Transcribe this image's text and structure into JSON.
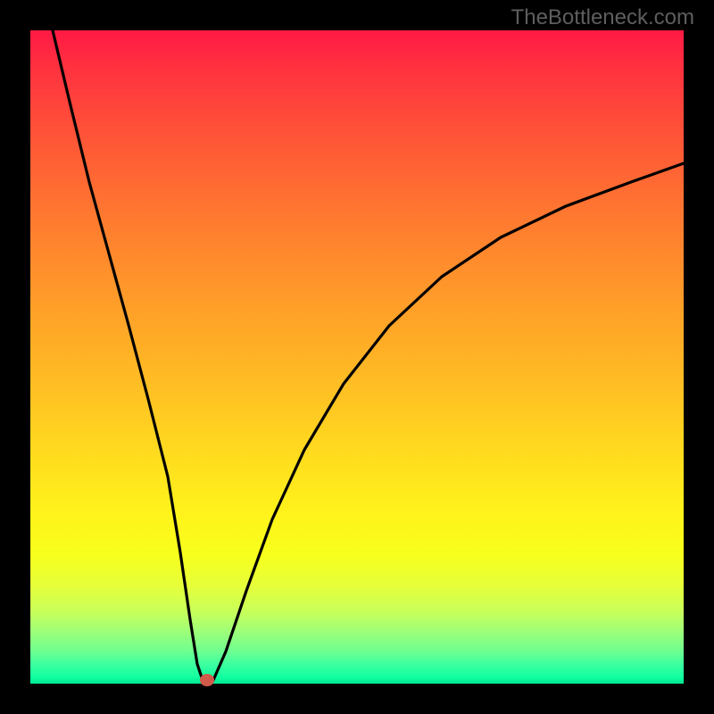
{
  "watermark": "TheBottleneck.com",
  "chart_data": {
    "type": "line",
    "title": "",
    "xlabel": "",
    "ylabel": "",
    "xlim": [
      0,
      100
    ],
    "ylim": [
      0,
      100
    ],
    "background_gradient": {
      "top": "#ff1a44",
      "bottom": "#00e693",
      "direction": "vertical"
    },
    "series": [
      {
        "name": "curve",
        "x": [
          3.5,
          6,
          9,
          12,
          15,
          18,
          21,
          23,
          24.5,
          25.5,
          26.5,
          28,
          30,
          33,
          37,
          42,
          48,
          55,
          63,
          72,
          82,
          92,
          100
        ],
        "y": [
          100,
          89,
          77,
          66,
          55,
          44,
          32,
          20,
          10,
          3,
          0,
          0.5,
          5,
          14,
          25,
          36,
          46,
          55,
          62,
          68,
          73,
          77,
          80
        ]
      }
    ],
    "marker": {
      "name": "minimum-dot",
      "x": 27,
      "y": 0.5,
      "color": "#d15a4a"
    }
  }
}
